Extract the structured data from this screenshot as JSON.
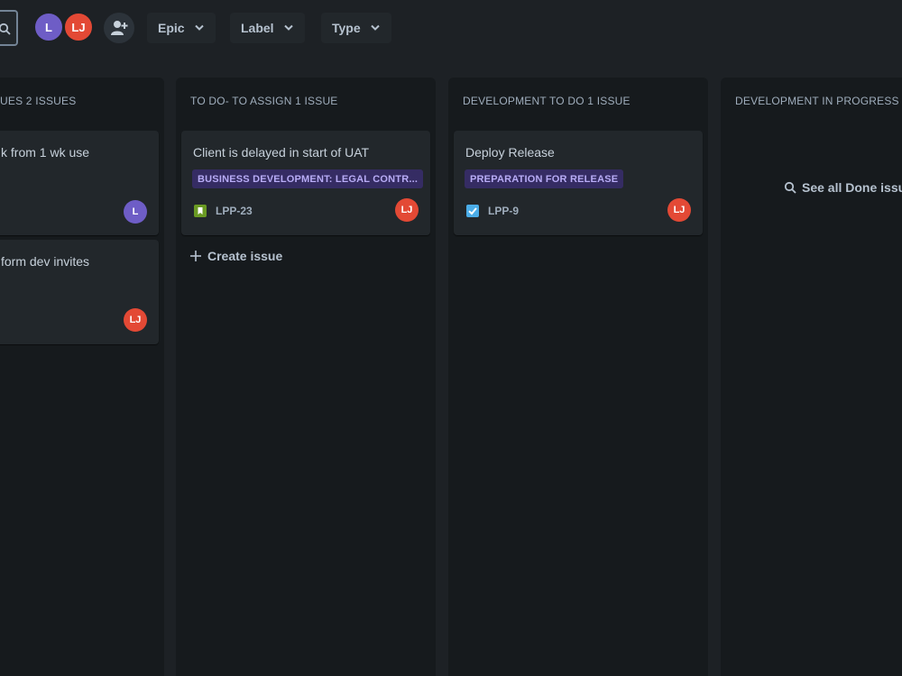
{
  "toolbar": {
    "avatars": [
      {
        "initials": "L",
        "color": "#6e5dc6"
      },
      {
        "initials": "LJ",
        "color": "#e34935"
      }
    ],
    "filters": [
      {
        "label": "Epic"
      },
      {
        "label": "Label"
      },
      {
        "label": "Type"
      }
    ]
  },
  "columns": [
    {
      "title": "UES 2 ISSUES",
      "cards": [
        {
          "title": "k from 1 wk use",
          "assignee": "L"
        },
        {
          "title": "form dev invites",
          "assignee": "LJ"
        }
      ]
    },
    {
      "title": "TO DO- TO ASSIGN 1 ISSUE",
      "cards": [
        {
          "title": "Client is delayed in start of UAT",
          "epic": "BUSINESS DEVELOPMENT: LEGAL CONTR...",
          "type": "story",
          "key": "LPP-23",
          "assignee": "LJ"
        }
      ],
      "create_label": "Create issue"
    },
    {
      "title": "DEVELOPMENT TO DO 1 ISSUE",
      "cards": [
        {
          "title": "Deploy Release",
          "epic": "PREPARATION FOR RELEASE",
          "type": "task",
          "key": "LPP-9",
          "assignee": "LJ"
        }
      ]
    },
    {
      "title": "DEVELOPMENT IN PROGRESS",
      "see_done_label": "See all Done issu"
    }
  ],
  "colors": {
    "background": "#1d2125",
    "column": "#161a1d",
    "card": "#22272b",
    "epic_bg": "#352c63",
    "epic_text": "#b8acf6"
  }
}
